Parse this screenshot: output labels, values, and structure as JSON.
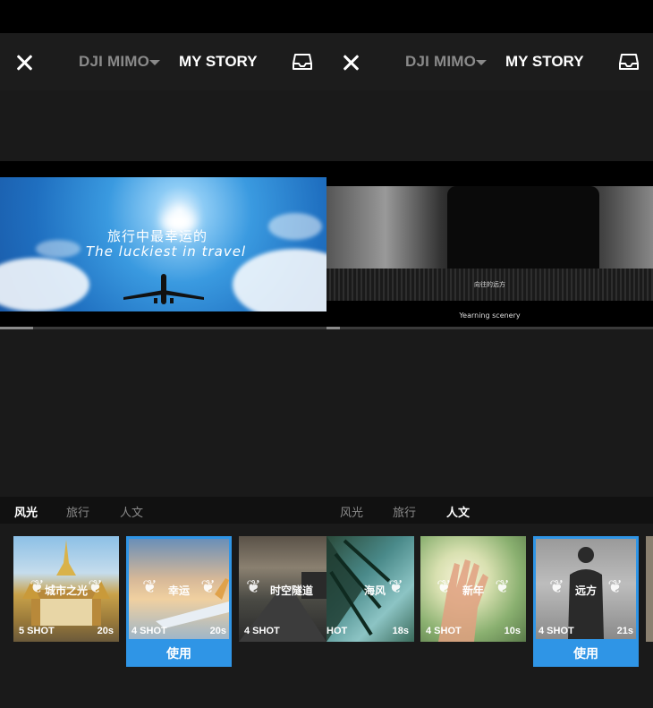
{
  "panels": [
    {
      "header": {
        "mimo_tab": "DJI MIMO",
        "story_tab": "MY STORY"
      },
      "preview": {
        "caption_cn": "旅行中最幸运的",
        "caption_en": "The luckiest in travel"
      },
      "progress": 0.1,
      "categories": [
        {
          "label": "风光",
          "active": true
        },
        {
          "label": "旅行",
          "active": false
        },
        {
          "label": "人文",
          "active": false
        }
      ],
      "cards": [
        {
          "title": "城市之光",
          "shots": "5 SHOT",
          "duration": "20s",
          "theme": "temple"
        },
        {
          "title": "幸运",
          "shots": "4 SHOT",
          "duration": "20s",
          "theme": "plane",
          "selected": true,
          "use_label": "使用"
        },
        {
          "title": "时空隧道",
          "shots": "4 SHOT",
          "duration": "",
          "theme": "road"
        }
      ]
    },
    {
      "header": {
        "mimo_tab": "DJI MIMO",
        "story_tab": "MY STORY"
      },
      "preview": {
        "caption_cn": "向往的远方",
        "caption_en": "Yearning scenery"
      },
      "progress": 0.04,
      "categories": [
        {
          "label": "风光",
          "active": false
        },
        {
          "label": "旅行",
          "active": false
        },
        {
          "label": "人文",
          "active": true
        }
      ],
      "cards": [
        {
          "title": "海风",
          "shots": "HOT",
          "duration": "18s",
          "theme": "palm"
        },
        {
          "title": "新年",
          "shots": "4 SHOT",
          "duration": "10s",
          "theme": "hand"
        },
        {
          "title": "远方",
          "shots": "4 SHOT",
          "duration": "21s",
          "theme": "person",
          "selected": true,
          "use_label": "使用"
        }
      ]
    }
  ],
  "colors": {
    "accent": "#2f95e6",
    "background": "#1a1a1a"
  }
}
